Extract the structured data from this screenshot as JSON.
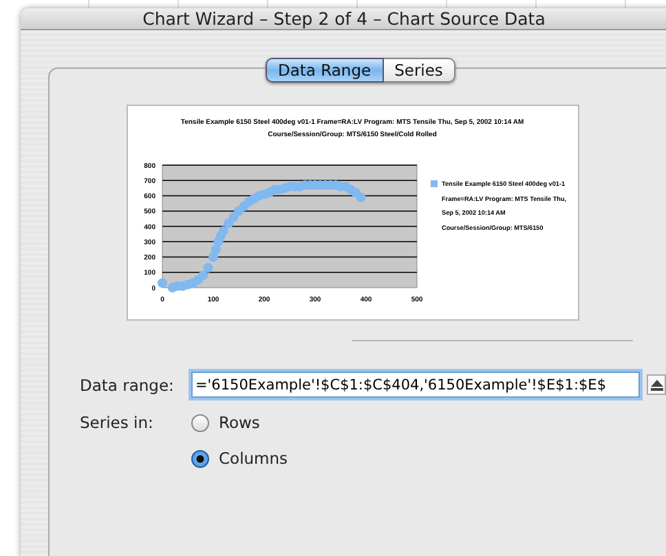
{
  "window": {
    "title": "Chart Wizard – Step 2 of 4 – Chart Source Data"
  },
  "tabs": [
    {
      "label": "Data Range",
      "selected": true
    },
    {
      "label": "Series",
      "selected": false
    }
  ],
  "chart": {
    "chart_data": {
      "type": "scatter",
      "title": "Tensile Example 6150 Steel 400deg v01-1 Frame=RA:LV Program: MTS Tensile Thu, Sep 5, 2002 10:14 AM Course/Session/Group: MTS/6150 Steel/Cold Rolled",
      "xlim": [
        0,
        500
      ],
      "ylim": [
        0,
        800
      ],
      "xticks": [
        0,
        100,
        200,
        300,
        400,
        500
      ],
      "yticks": [
        0,
        100,
        200,
        300,
        400,
        500,
        600,
        700,
        800
      ],
      "grid": true,
      "x": [
        0,
        20,
        30,
        40,
        50,
        60,
        70,
        80,
        90,
        100,
        105,
        110,
        115,
        120,
        130,
        140,
        150,
        160,
        170,
        180,
        190,
        200,
        210,
        220,
        230,
        240,
        250,
        260,
        270,
        280,
        290,
        300,
        310,
        320,
        330,
        340,
        350,
        360,
        370,
        380,
        390
      ],
      "series": [
        {
          "name": "Tensile Example 6150 Steel 400deg v01-1 Frame=RA:LV Program: MTS Tensile Thu, Sep 5, 2002 10:14 AM Course/Session/Group: MTS/6150",
          "color": "#80b8f0",
          "values": [
            30,
            0,
            10,
            10,
            20,
            30,
            50,
            80,
            130,
            200,
            250,
            300,
            340,
            370,
            420,
            460,
            500,
            530,
            560,
            580,
            600,
            610,
            620,
            640,
            640,
            650,
            660,
            660,
            660,
            670,
            670,
            670,
            670,
            670,
            670,
            670,
            660,
            660,
            640,
            620,
            590
          ]
        }
      ]
    }
  },
  "data_range": {
    "label": "Data range:",
    "value": "='6150Example'!$C$1:$C$404,'6150Example'!$E$1:$E$"
  },
  "series_in": {
    "label": "Series in:",
    "options": [
      {
        "label": "Rows",
        "selected": false
      },
      {
        "label": "Columns",
        "selected": true
      }
    ]
  }
}
